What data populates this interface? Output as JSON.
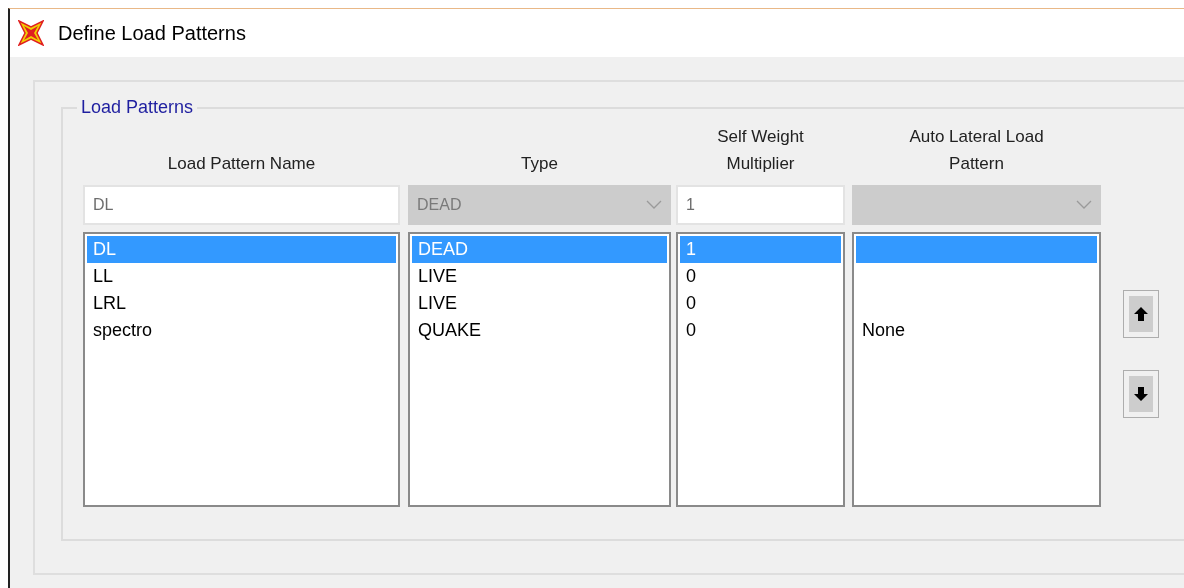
{
  "window": {
    "title": "Define Load Patterns"
  },
  "group": {
    "title": "Load Patterns"
  },
  "columns": [
    {
      "header": "Load Pattern Name",
      "input": {
        "kind": "text",
        "value": "DL",
        "disabled": false
      },
      "items": [
        {
          "text": "DL",
          "selected": true
        },
        {
          "text": "LL",
          "selected": false
        },
        {
          "text": "LRL",
          "selected": false
        },
        {
          "text": "spectro",
          "selected": false
        }
      ]
    },
    {
      "header": "Type",
      "input": {
        "kind": "dropdown",
        "value": "DEAD",
        "disabled": true
      },
      "items": [
        {
          "text": "DEAD",
          "selected": true
        },
        {
          "text": "LIVE",
          "selected": false
        },
        {
          "text": "LIVE",
          "selected": false
        },
        {
          "text": "QUAKE",
          "selected": false
        }
      ]
    },
    {
      "header": "Self Weight Multiplier",
      "input": {
        "kind": "text",
        "value": "1",
        "disabled": false
      },
      "items": [
        {
          "text": "1",
          "selected": true
        },
        {
          "text": "0",
          "selected": false
        },
        {
          "text": "0",
          "selected": false
        },
        {
          "text": "0",
          "selected": false
        }
      ]
    },
    {
      "header": "Auto Lateral Load Pattern",
      "input": {
        "kind": "dropdown",
        "disabled": true
      },
      "items": [
        {
          "selected": true
        },
        {
          "selected": false
        },
        {
          "selected": false
        },
        {
          "text": "None",
          "selected": false
        }
      ]
    }
  ],
  "move_buttons": [
    {
      "kind": "up"
    },
    {
      "kind": "down"
    }
  ]
}
